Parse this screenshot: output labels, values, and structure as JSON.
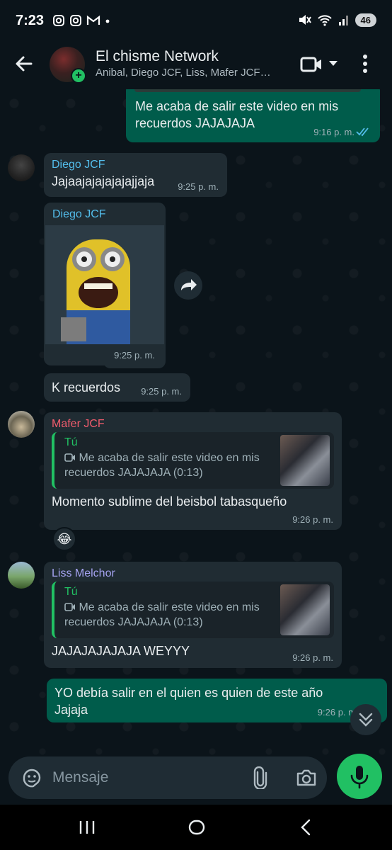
{
  "status": {
    "time": "7:23",
    "battery": "46"
  },
  "header": {
    "title": "El chisme Network",
    "members": "Anibal, Diego JCF, Liss, Mafer JCF…"
  },
  "messages": [
    {
      "kind": "out",
      "text": "Me acaba de salir este video en mis recuerdos JAJAJAJA",
      "time": "9:16 p. m."
    },
    {
      "kind": "in",
      "sender": "Diego JCF",
      "sender_color": "#53bdeb",
      "text": "Jajaajajajajajajjaja",
      "time": "9:25 p. m."
    },
    {
      "kind": "in-gif",
      "sender": "Diego JCF",
      "sender_color": "#53bdeb",
      "time": "9:25 p. m."
    },
    {
      "kind": "in",
      "text": "K recuerdos",
      "time": "9:25 p. m."
    },
    {
      "kind": "reply",
      "sender": "Mafer JCF",
      "sender_color": "#f15c6d",
      "quote_author": "Tú",
      "quote_text": "Me acaba de salir este video en mis recuerdos JAJAJAJA (0:13)",
      "text": "Momento sublime del beisbol tabasqueño",
      "time": "9:26 p. m.",
      "reaction": "😂"
    },
    {
      "kind": "reply",
      "sender": "Liss Melchor",
      "sender_color": "#a5a3f0",
      "quote_author": "Tú",
      "quote_text": "Me acaba de salir este video en mis recuerdos JAJAJAJA (0:13)",
      "text": "JAJAJAJAJAJA WEYYY",
      "time": "9:26 p. m."
    },
    {
      "kind": "out",
      "text": "YO debía salir en el quien es quien de este año Jajaja",
      "time": "9:26 p. m"
    }
  ],
  "composer": {
    "placeholder": "Mensaje"
  },
  "colors": {
    "accent": "#21c063",
    "outgoing": "#005c4b",
    "incoming": "#202c33",
    "read_ticks": "#53bdeb"
  }
}
